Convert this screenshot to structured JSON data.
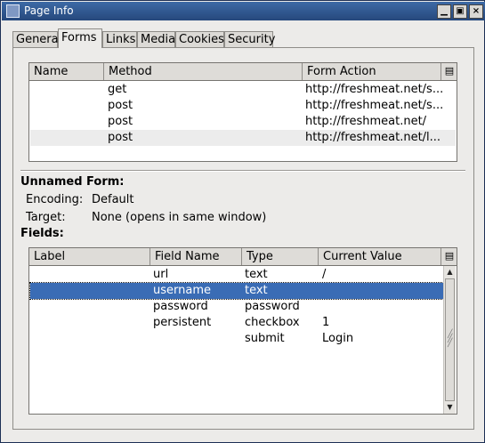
{
  "window": {
    "title": "Page Info"
  },
  "tabs": [
    "General",
    "Forms",
    "Links",
    "Media",
    "Cookies",
    "Security"
  ],
  "active_tab": "Forms",
  "forms_table": {
    "columns": [
      "Name",
      "Method",
      "Form Action"
    ],
    "rows": [
      {
        "name": "",
        "method": "get",
        "action": "http://freshmeat.net/s..."
      },
      {
        "name": "",
        "method": "post",
        "action": "http://freshmeat.net/s..."
      },
      {
        "name": "",
        "method": "post",
        "action": "http://freshmeat.net/"
      },
      {
        "name": "",
        "method": "post",
        "action": "http://freshmeat.net/l..."
      }
    ]
  },
  "form_details": {
    "heading": "Unnamed Form:",
    "encoding_label": "Encoding:",
    "encoding_value": "Default",
    "target_label": "Target:",
    "target_value": "None (opens in same window)",
    "fields_label": "Fields:"
  },
  "fields_table": {
    "columns": [
      "Label",
      "Field Name",
      "Type",
      "Current Value"
    ],
    "rows": [
      {
        "label": "",
        "field_name": "url",
        "type": "text",
        "value": "/"
      },
      {
        "label": "",
        "field_name": "username",
        "type": "text",
        "value": ""
      },
      {
        "label": "",
        "field_name": "password",
        "type": "password",
        "value": ""
      },
      {
        "label": "",
        "field_name": "persistent",
        "type": "checkbox",
        "value": "1"
      },
      {
        "label": "",
        "field_name": "",
        "type": "submit",
        "value": "Login"
      }
    ],
    "selected_row": 1
  },
  "icons": {
    "title": "window-icon",
    "column_picker": "column-picker-icon",
    "scroll_up": "arrow-up-icon",
    "scroll_down": "arrow-down-icon"
  },
  "colors": {
    "titlebar": "#2f5a92",
    "selection": "#3a6cb5",
    "window_bg": "#ecebe9"
  }
}
